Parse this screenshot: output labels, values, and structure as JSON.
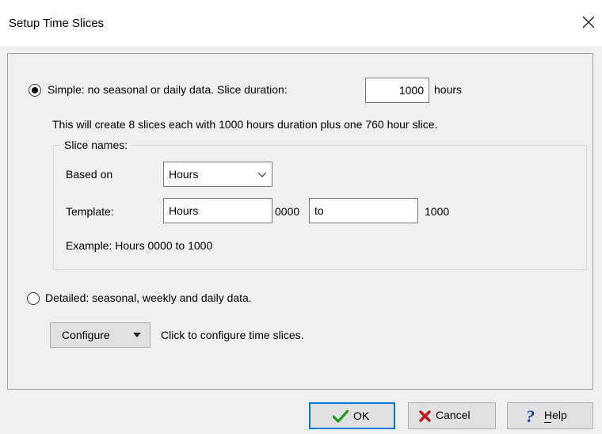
{
  "window": {
    "title": "Setup Time Slices",
    "close_icon": "close-icon"
  },
  "simple": {
    "label": "Simple: no seasonal or daily data.  Slice duration:",
    "selected": true,
    "duration_value": "1000",
    "duration_unit": "hours",
    "description": "This will create 8 slices each with 1000 hours duration plus one 760 hour slice."
  },
  "slice_names": {
    "legend": "Slice names:",
    "based_on_label": "Based on",
    "based_on_value": "Hours",
    "template_label": "Template:",
    "template_prefix": "Hours",
    "template_start": "0000",
    "template_separator": "to",
    "template_end": "1000",
    "example": "Example: Hours 0000 to 1000"
  },
  "detailed": {
    "label": "Detailed: seasonal, weekly and daily data.",
    "selected": false,
    "configure_button": "Configure",
    "configure_hint": "Click to configure time slices."
  },
  "footer": {
    "ok_label": "OK",
    "cancel_label": "Cancel",
    "help_label": "Help"
  },
  "colors": {
    "ok_check": "#1a9c1a",
    "cancel_x": "#c01818",
    "help_q": "#1a3fbf",
    "default_border": "#0078d7"
  }
}
